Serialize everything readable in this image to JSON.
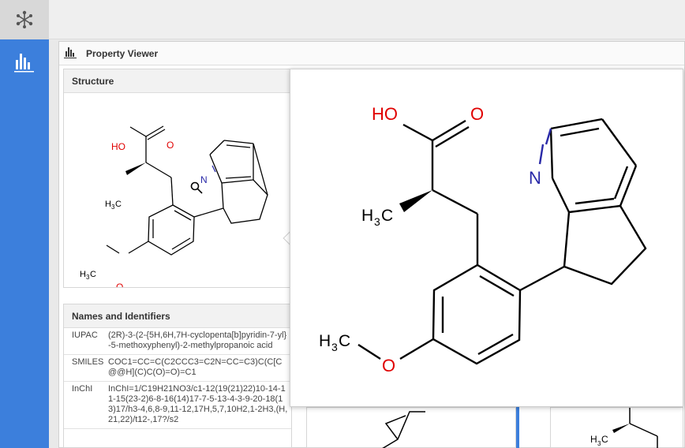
{
  "sidebar": {
    "logo_icon": "molecule-network-icon",
    "nav_icon": "bar-chart-icon",
    "color": "#3c7fdc"
  },
  "panel": {
    "title": "Property Viewer",
    "icon": "bar-chart-icon"
  },
  "structure": {
    "title": "Structure",
    "zoom_icon": "magnifier-icon"
  },
  "molecule_labels": {
    "hydroxyl": "HO",
    "oxygen": "O",
    "nitrogen": "N",
    "methyl_h": "H",
    "methyl_3": "3",
    "methyl_c": "C",
    "carbon_color": "#000000",
    "oxygen_color": "#e00000",
    "nitrogen_color": "#2a2aa8"
  },
  "names": {
    "title": "Names and Identifiers",
    "rows": [
      {
        "key": "IUPAC",
        "value": "(2R)-3-(2-{5H,6H,7H-cyclopenta[b]pyridin-7-yl}-5-methoxyphenyl)-2-methylpropanoic acid"
      },
      {
        "key": "SMILES",
        "value": "COC1=CC=C(C2CCC3=C2N=CC=C3)C(C[C@@H](C)C(O)=O)=C1"
      },
      {
        "key": "InChI",
        "value": "InChI=1/C19H21NO3/c1-12(19(21)22)10-14-11-15(23-2)6-8-16(14)17-7-5-13-4-3-9-20-18(13)17/h3-4,6,8-9,11-12,17H,5,7,10H2,1-2H3,(H,21,22)/t12-,17?/s2"
      }
    ]
  }
}
